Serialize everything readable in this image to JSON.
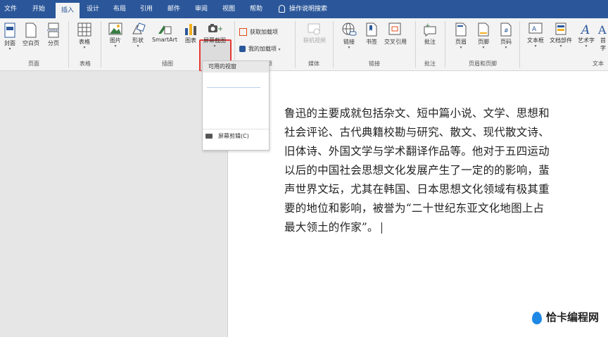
{
  "tabs": [
    {
      "label": "文件"
    },
    {
      "label": "开始"
    },
    {
      "label": "插入"
    },
    {
      "label": "设计"
    },
    {
      "label": "布局"
    },
    {
      "label": "引用"
    },
    {
      "label": "邮件"
    },
    {
      "label": "审阅"
    },
    {
      "label": "视图"
    },
    {
      "label": "帮助"
    }
  ],
  "tell_me": "操作说明搜索",
  "ribbon": {
    "pages": {
      "cover": "封面",
      "blank": "空白页",
      "break": "分页",
      "group": "页面"
    },
    "tables": {
      "table": "表格",
      "group": "表格"
    },
    "illustrations": {
      "picture": "图片",
      "shapes": "形状",
      "smartart": "SmartArt",
      "chart": "图表",
      "screenshot": "屏幕截图",
      "group": "插图"
    },
    "addins": {
      "get": "获取加载项",
      "mine": "我的加载项",
      "group": "项"
    },
    "media": {
      "online_video": "联机视频",
      "group": "媒体"
    },
    "links": {
      "link": "链接",
      "bookmark": "书签",
      "crossref": "交叉引用",
      "group": "链接"
    },
    "comments": {
      "comment": "批注",
      "group": "批注"
    },
    "header_footer": {
      "header": "页眉",
      "footer": "页脚",
      "pagenum": "页码",
      "group": "页眉和页脚"
    },
    "text": {
      "textbox": "文本框",
      "quickparts": "文档部件",
      "wordart": "艺术字",
      "dropcap": "首字",
      "group": "文本"
    }
  },
  "dropdown": {
    "header": "可用的视窗",
    "clipping": "屏幕剪辑(C)"
  },
  "document": {
    "paragraph": "鲁迅的主要成就包括杂文、短中篇小说、文学、思想和社会评论、古代典籍校勘与研究、散文、现代散文诗、旧体诗、外国文学与学术翻译作品等。他对于五四运动以后的中国社会思想文化发展产生了一定的的影响，蜚声世界文坛，尤其在韩国、日本思想文化领域有极其重要的地位和影响，被誉为“二十世纪东亚文化地图上占最大领土的作家”。"
  },
  "watermark": "恰卡编程网",
  "colors": {
    "brand": "#2b579a",
    "highlight": "#e53935"
  }
}
